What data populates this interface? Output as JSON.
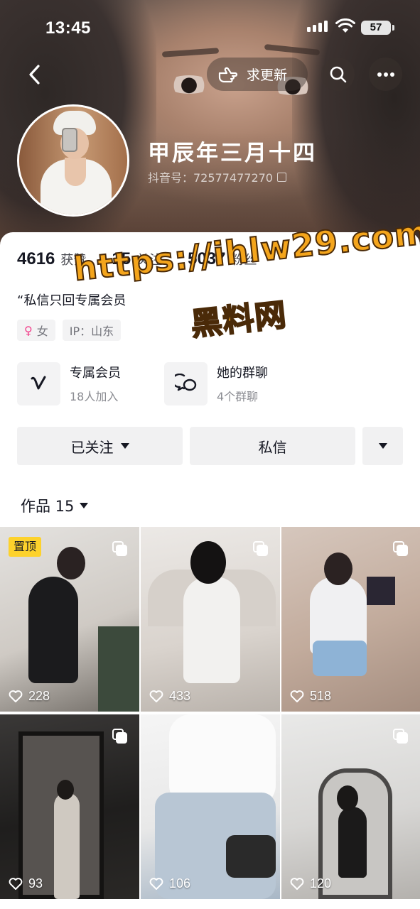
{
  "status_bar": {
    "time": "13:45",
    "battery": "57"
  },
  "header": {
    "request_update_label": "求更新",
    "nickname": "甲辰年三月十四",
    "douyin_id": "抖音号：72577477270"
  },
  "stats": [
    {
      "value": "4616",
      "label": "获赞"
    },
    {
      "value": "15",
      "label": "关注"
    },
    {
      "value": "5037",
      "label": "粉丝"
    }
  ],
  "bio": "“私信只回专属会员",
  "tags": {
    "gender": "女",
    "ip": "IP：山东"
  },
  "features": [
    {
      "title": "专属会员",
      "subtitle": "18人加入",
      "icon": "v-logo-icon"
    },
    {
      "title": "她的群聊",
      "subtitle": "4个群聊",
      "icon": "chat-bubbles-icon"
    }
  ],
  "actions": {
    "follow": "已关注",
    "message": "私信"
  },
  "works": {
    "label": "作品 15"
  },
  "grid": [
    {
      "likes": "228",
      "pinned": "置顶"
    },
    {
      "likes": "433"
    },
    {
      "likes": "518"
    },
    {
      "likes": "93"
    },
    {
      "likes": "106"
    },
    {
      "likes": "120"
    }
  ],
  "watermark": {
    "line1": "https://ihlw29.com",
    "line2": "黑料网"
  },
  "colors": {
    "pin_badge": "#fdd22c",
    "watermark": "#f4a51c",
    "female": "#f23e8a"
  }
}
